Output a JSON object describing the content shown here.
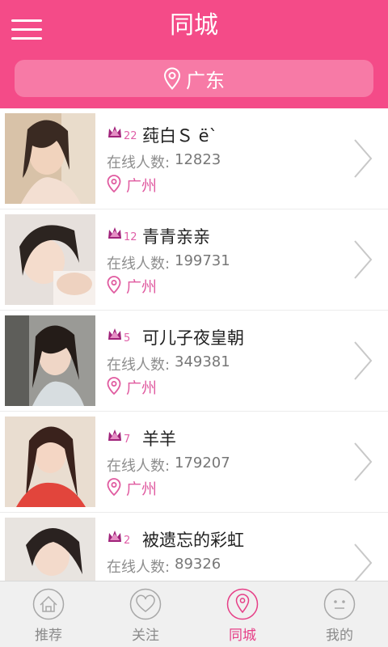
{
  "header": {
    "title": "同城",
    "location": "广东"
  },
  "colors": {
    "accent": "#f44b88",
    "location_bar": "#f77aa6",
    "active_tab": "#e63f87",
    "city": "#e05ba0"
  },
  "list": {
    "online_label": "在线人数:",
    "items": [
      {
        "name": "莼白Ｓ ё`",
        "level": "22",
        "online": "12823",
        "city": "广州"
      },
      {
        "name": "青青亲亲",
        "level": "12",
        "online": "199731",
        "city": "广州"
      },
      {
        "name": "可儿子夜皇朝",
        "level": "5",
        "online": "349381",
        "city": "广州"
      },
      {
        "name": "羊羊",
        "level": "7",
        "online": "179207",
        "city": "广州"
      },
      {
        "name": "被遗忘的彩虹",
        "level": "2",
        "online": "89326",
        "city": ""
      }
    ]
  },
  "tabs": [
    {
      "label": "推荐",
      "icon": "home-icon"
    },
    {
      "label": "关注",
      "icon": "heart-icon"
    },
    {
      "label": "同城",
      "icon": "location-pin-icon",
      "active": true
    },
    {
      "label": "我的",
      "icon": "face-icon"
    }
  ]
}
